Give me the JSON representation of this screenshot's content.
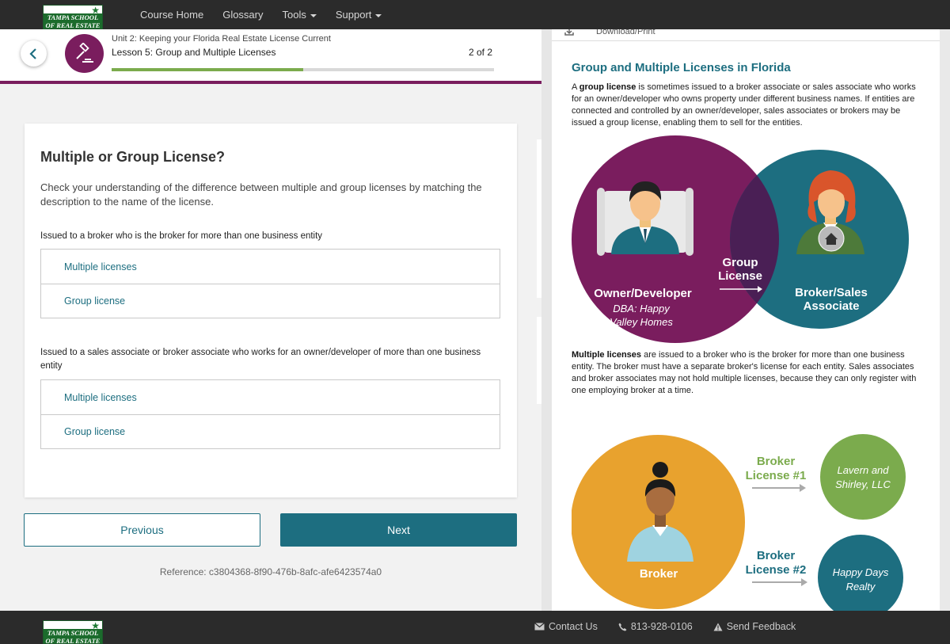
{
  "nav": {
    "logo_line1": "TAMPA SCHOOL",
    "logo_line2": "OF REAL ESTATE",
    "items": [
      {
        "label": "Course Home"
      },
      {
        "label": "Glossary"
      },
      {
        "label": "Tools"
      },
      {
        "label": "Support"
      }
    ]
  },
  "lesson": {
    "unit": "Unit 2: Keeping your Florida Real Estate License Current",
    "title": "Lesson 5: Group and Multiple Licenses",
    "page": "2 of 2",
    "progress_fraction": 0.5,
    "icon": "gavel-icon"
  },
  "quiz": {
    "title": "Multiple or Group License?",
    "intro": "Check your understanding of the difference between multiple and group licenses by matching the description to the name of the license.",
    "questions": [
      {
        "text": "Issued to a broker who is the broker for more than one business entity",
        "options": [
          "Multiple licenses",
          "Group license"
        ]
      },
      {
        "text": "Issued to a sales associate or broker associate who works for an owner/developer of more than one business entity",
        "options": [
          "Multiple licenses",
          "Group license"
        ]
      }
    ]
  },
  "buttons": {
    "previous": "Previous",
    "next": "Next"
  },
  "reference": "Reference: c3804368-8f90-476b-8afc-afe6423574a0",
  "right": {
    "download": "Download/Print",
    "title": "Group and Multiple Licenses in Florida",
    "para1_bold": "group license",
    "para1_pre": "A ",
    "para1_rest": " is sometimes issued to a broker associate or sales associate who works for an owner/developer who owns property under different business names. If entities are connected and controlled by an owner/developer, sales associates or brokers may be issued a group license, enabling them to sell for the entities.",
    "venn": {
      "left_label": "Owner/Developer",
      "left_sub1": "DBA: Happy",
      "left_sub2": "Valley Homes",
      "center_line1": "Group",
      "center_line2": "License",
      "right_line1": "Broker/Sales",
      "right_line2": "Associate",
      "colors": {
        "left": "#7a1d5e",
        "right": "#1d6e80",
        "overlap": "#4a1f55"
      }
    },
    "para2_bold": "Multiple licenses",
    "para2_rest": " are issued to a broker who is the broker for more than one business entity. The broker must have a separate broker's license for each entity. Sales associates and broker associates may not hold multiple licenses, because they can only register with one employing broker at a time.",
    "diagram2": {
      "broker_label": "Broker",
      "license1_line1": "Broker",
      "license1_line2": "License #1",
      "entity1_line1": "Lavern and",
      "entity1_line2": "Shirley, LLC",
      "license2_line1": "Broker",
      "license2_line2": "License #2",
      "entity2_line1": "Happy Days",
      "entity2_line2": "Realty",
      "colors": {
        "broker": "#e8a22e",
        "entity1": "#7bab4d",
        "entity2": "#1d6e80"
      }
    }
  },
  "footer": {
    "contact": "Contact Us",
    "phone": "813-928-0106",
    "feedback": "Send Feedback"
  }
}
